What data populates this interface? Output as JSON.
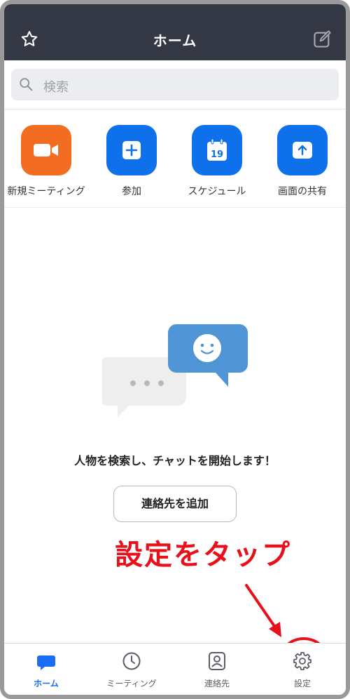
{
  "header": {
    "title": "ホーム",
    "star_icon": "star-icon",
    "compose_icon": "compose-icon"
  },
  "search": {
    "placeholder": "検索"
  },
  "actions": [
    {
      "label": "新規ミーティング",
      "icon": "video-camera-icon",
      "color": "#f26d21"
    },
    {
      "label": "参加",
      "icon": "plus-icon",
      "color": "#0e71eb"
    },
    {
      "label": "スケジュール",
      "icon": "calendar-icon",
      "color": "#0e71eb",
      "calendar_day": "19"
    },
    {
      "label": "画面の共有",
      "icon": "share-screen-icon",
      "color": "#0e71eb"
    }
  ],
  "empty_state": {
    "message": "人物を検索し、チャットを開始します！",
    "add_contact_label": "連絡先を追加"
  },
  "annotation": {
    "text": "設定をタップ",
    "color": "#e8101a"
  },
  "tabbar": [
    {
      "label": "ホーム",
      "icon": "chat-bubble-icon",
      "active": true
    },
    {
      "label": "ミーティング",
      "icon": "clock-icon",
      "active": false
    },
    {
      "label": "連絡先",
      "icon": "contact-icon",
      "active": false
    },
    {
      "label": "設定",
      "icon": "gear-icon",
      "active": false
    }
  ],
  "colors": {
    "header_bg": "#343744",
    "accent": "#1a6ef5"
  }
}
